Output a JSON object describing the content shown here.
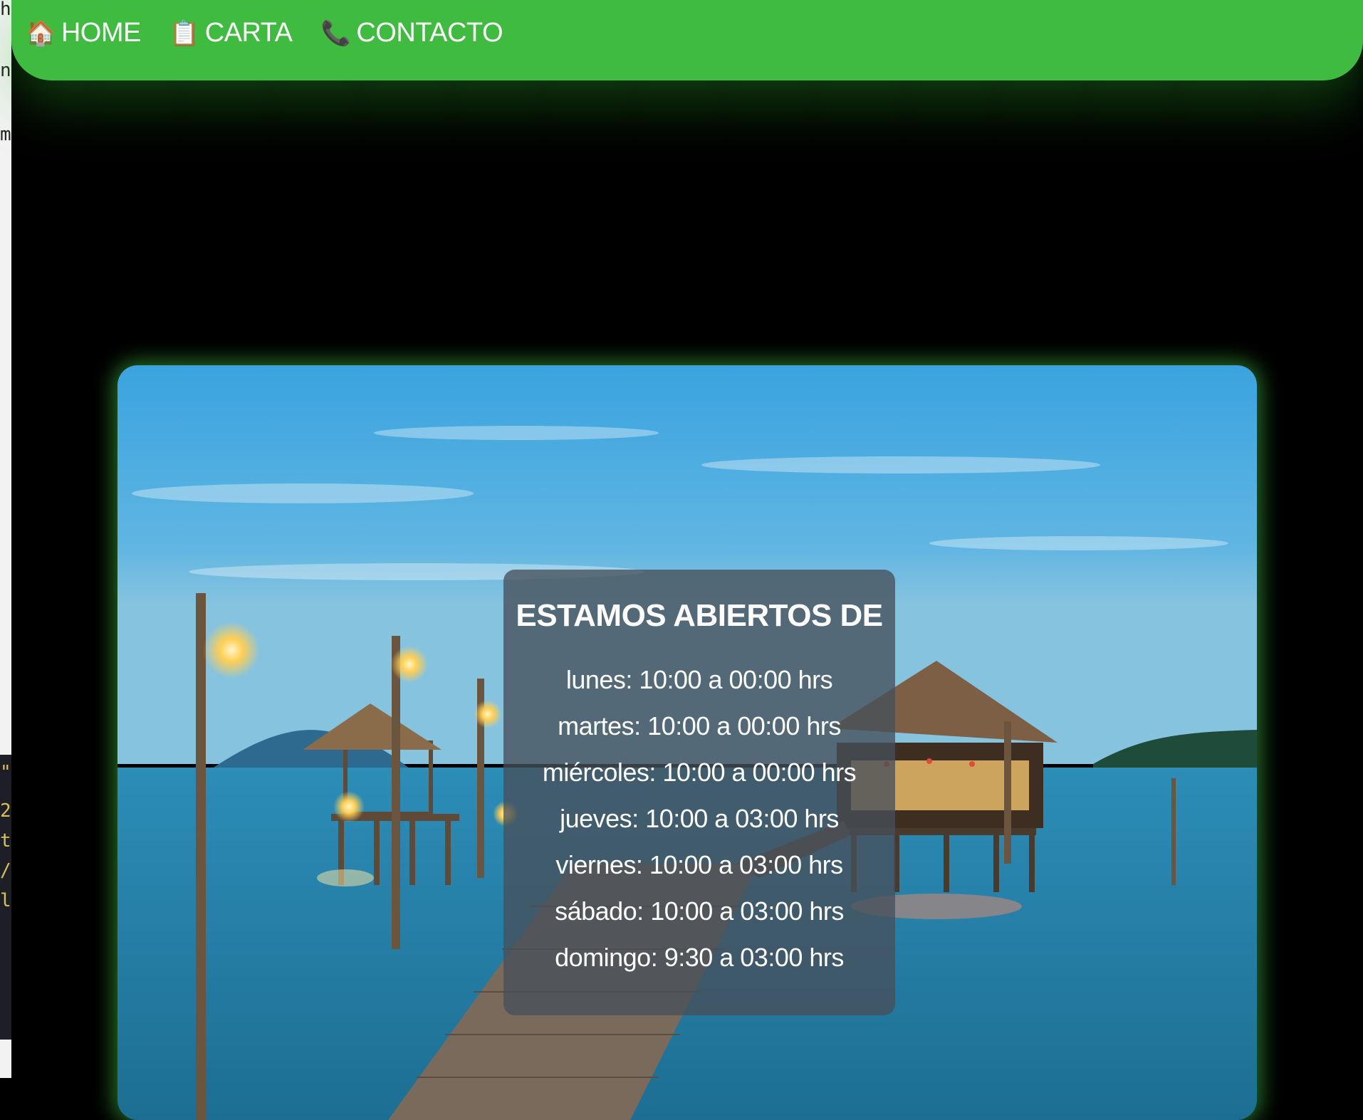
{
  "nav": {
    "items": [
      {
        "icon": "house-icon",
        "glyph": "🏠",
        "label": "HOME"
      },
      {
        "icon": "clipboard-icon",
        "glyph": "📋",
        "label": "CARTA"
      },
      {
        "icon": "telephone-icon",
        "glyph": "📞",
        "label": "CONTACTO"
      }
    ]
  },
  "hours": {
    "title": "ESTAMOS ABIERTOS DE",
    "days": [
      "lunes: 10:00 a 00:00 hrs",
      "martes: 10:00 a 00:00 hrs",
      "miércoles: 10:00 a 00:00 hrs",
      "jueves: 10:00 a 03:00 hrs",
      "viernes: 10:00 a 03:00 hrs",
      "sábado: 10:00 a 03:00 hrs",
      "domingo: 9:30 a 03:00 hrs"
    ]
  },
  "colors": {
    "nav_bg": "#3fbb3f",
    "page_bg": "#000000",
    "glow": "#46c846"
  },
  "side_strip": {
    "fragments": [
      "h",
      "nl",
      "m",
      "\"",
      "2",
      "t",
      "/",
      "l"
    ]
  }
}
